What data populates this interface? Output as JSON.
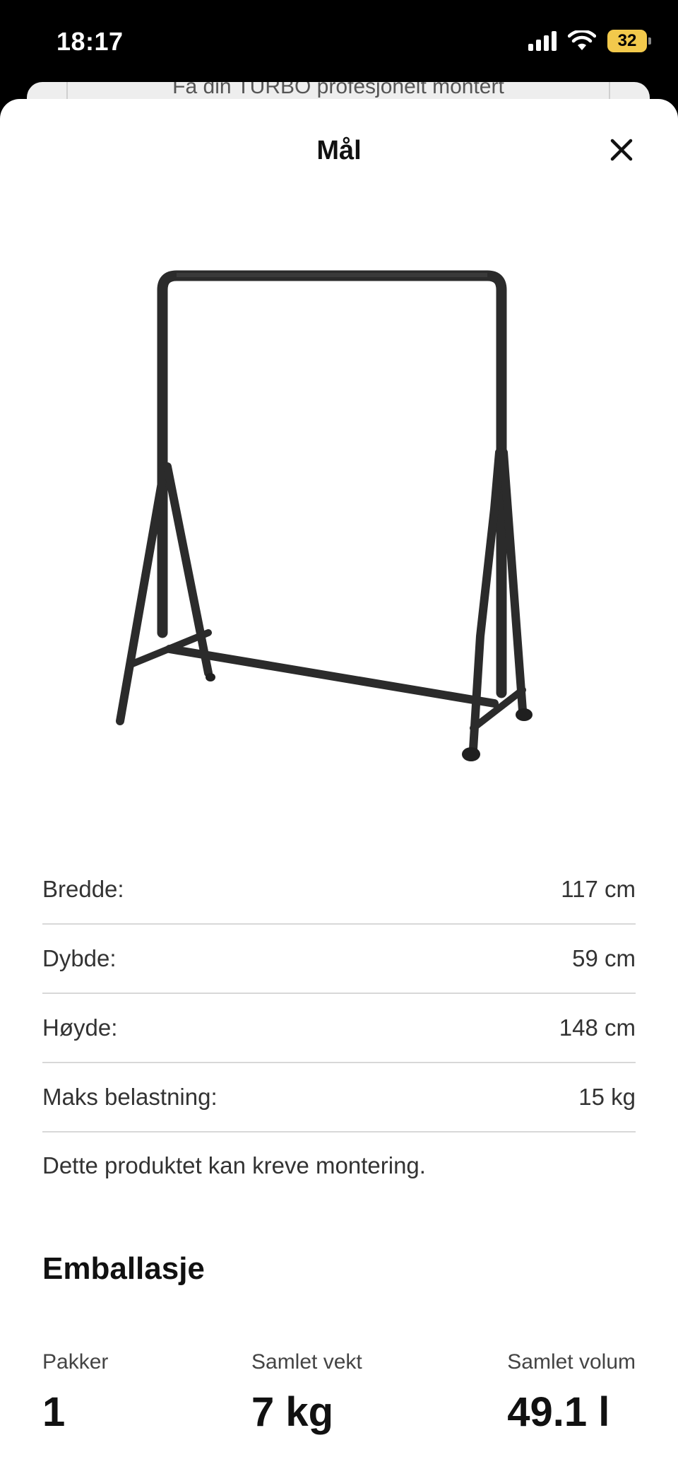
{
  "status": {
    "time": "18:17",
    "battery": "32",
    "icons": [
      "signal-icon",
      "wifi-icon",
      "battery-icon"
    ],
    "battery_color": "#f2c94c"
  },
  "background_sheet": {
    "text": "Få din TURBO profesjonelt montert"
  },
  "sheet": {
    "title": "Mål",
    "close_icon": "close-icon"
  },
  "dimensions": [
    {
      "label": "Bredde:",
      "value": "117 cm"
    },
    {
      "label": "Dybde:",
      "value": "59 cm"
    },
    {
      "label": "Høyde:",
      "value": "148 cm"
    },
    {
      "label": "Maks belastning:",
      "value": "15 kg"
    }
  ],
  "assembly_note": "Dette produktet kan kreve montering.",
  "packaging": {
    "heading": "Emballasje",
    "stats": [
      {
        "label": "Pakker",
        "value": "1"
      },
      {
        "label": "Samlet vekt",
        "value": "7 kg"
      },
      {
        "label": "Samlet volum",
        "value": "49.1 l"
      }
    ]
  }
}
